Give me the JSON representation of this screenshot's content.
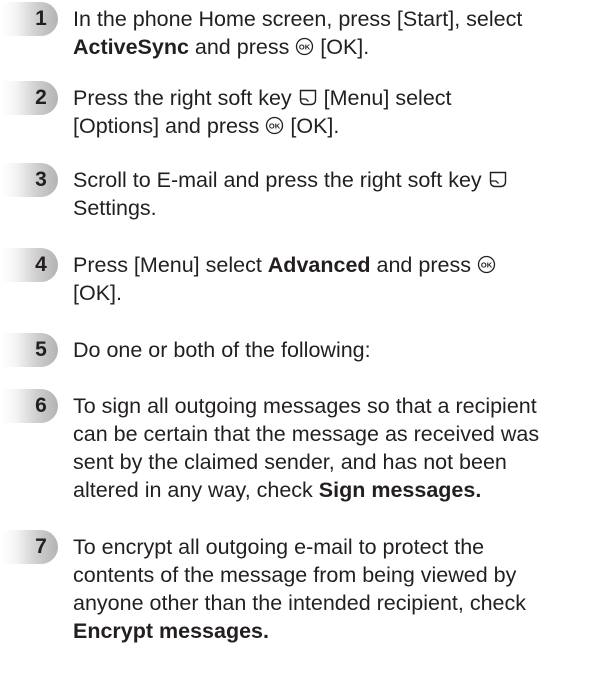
{
  "steps": [
    {
      "number": "1",
      "line1_a": "In the phone Home screen, press [Start], select",
      "line2_bold": "ActiveSync",
      "line2_b": " and press ",
      "ok_key_icon": "ok-key-icon",
      "line2_c": " [OK]."
    },
    {
      "number": "2",
      "line1_a": "Press the right soft key ",
      "soft_key_icon": "right-soft-key-icon",
      "line1_b": " [Menu] select",
      "line2_a": "[Options] and press ",
      "ok_key_icon": "ok-key-icon",
      "line2_b": " [OK]."
    },
    {
      "number": "3",
      "line1_a": "Scroll to E-mail and press the right soft key ",
      "soft_key_icon": "right-soft-key-icon",
      "line2": "Settings."
    },
    {
      "number": "4",
      "line1_a": "Press [Menu] select ",
      "line1_bold": "Advanced",
      "line1_b": " and press ",
      "ok_key_icon": "ok-key-icon",
      "line2": "[OK]."
    },
    {
      "number": "5",
      "line1": "Do one or both of the following:"
    },
    {
      "number": "6",
      "line1": "To sign all outgoing messages so that a recipient",
      "line2": "can be certain that the message as received was",
      "line3": "sent by the claimed sender, and has not been",
      "line4_a": "altered in any way, check ",
      "line4_bold": "Sign messages."
    },
    {
      "number": "7",
      "line1": "To encrypt all outgoing e-mail to protect the",
      "line2": "contents of the message from being viewed by",
      "line3": "anyone other than the intended recipient, check",
      "line4_bold": "Encrypt messages."
    }
  ]
}
